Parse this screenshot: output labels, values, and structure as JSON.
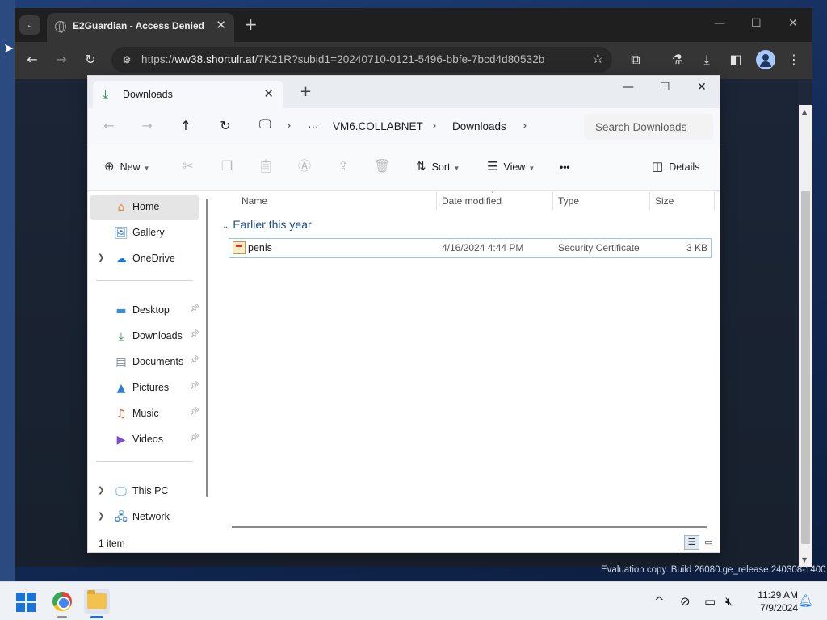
{
  "browser": {
    "tab_title": "E2Guardian - Access Denied",
    "url_scheme": "https://",
    "url_host": "ww38.shortulr.at",
    "url_path": "/7K21R?subid1=20240710-0121-5496-bbfe-7bcd4d80532b"
  },
  "explorer": {
    "tab_title": "Downloads",
    "breadcrumbs": [
      "VM6.COLLABNET",
      "Downloads"
    ],
    "search_placeholder": "Search Downloads",
    "commands": {
      "new": "New",
      "sort": "Sort",
      "view": "View",
      "more": "•••",
      "details": "Details"
    },
    "nav": {
      "home": "Home",
      "gallery": "Gallery",
      "onedrive": "OneDrive",
      "desktop": "Desktop",
      "downloads": "Downloads",
      "documents": "Documents",
      "pictures": "Pictures",
      "music": "Music",
      "videos": "Videos",
      "this_pc": "This PC",
      "network": "Network"
    },
    "columns": {
      "name": "Name",
      "date": "Date modified",
      "type": "Type",
      "size": "Size"
    },
    "group": "Earlier this year",
    "files": [
      {
        "name": "penis",
        "date": "4/16/2024 4:44 PM",
        "type": "Security Certificate",
        "size": "3 KB"
      }
    ],
    "status": "1 item"
  },
  "watermark": "Evaluation copy. Build 26080.ge_release.240308-1400",
  "taskbar": {
    "time": "11:29 AM",
    "date": "7/9/2024"
  },
  "colors": {
    "accent": "#1a73d9",
    "group_header": "#1e4f8c",
    "selection_border": "#99c5ea"
  }
}
